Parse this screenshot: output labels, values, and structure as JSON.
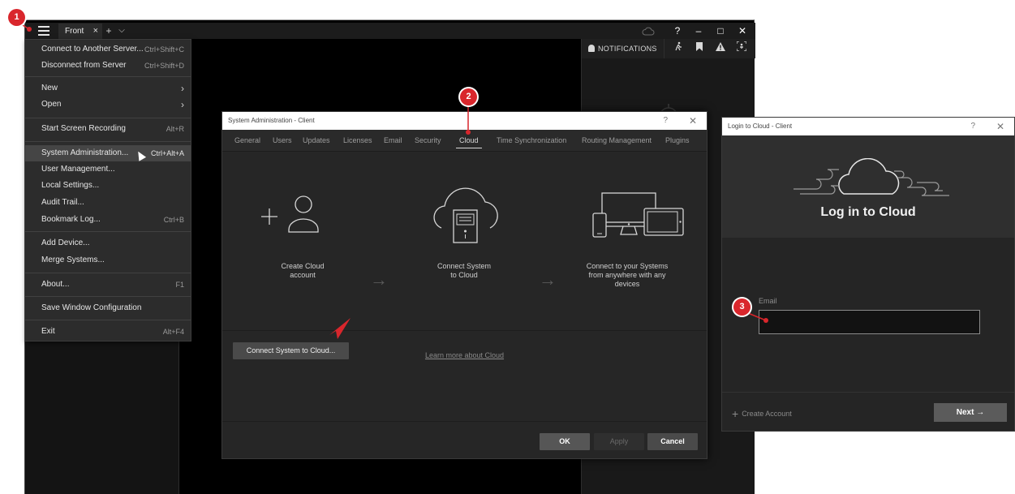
{
  "main_window": {
    "tab_label": "Front",
    "tab_close": "×",
    "add_tab": "+",
    "tab_menu": "⌵",
    "help": "?",
    "minimize": "–",
    "maximize": "□",
    "close": "✕",
    "notifications": {
      "label": "NOTIFICATIONS"
    }
  },
  "menu": {
    "items": [
      {
        "label": "Connect to Another Server...",
        "shortcut": "Ctrl+Shift+C"
      },
      {
        "label": "Disconnect from Server",
        "shortcut": "Ctrl+Shift+D"
      },
      {
        "label": "New",
        "shortcut": "›"
      },
      {
        "label": "Open",
        "shortcut": "›"
      },
      {
        "label": "Start Screen Recording",
        "shortcut": "Alt+R"
      },
      {
        "label": "System Administration...",
        "shortcut": "Ctrl+Alt+A"
      },
      {
        "label": "User Management...",
        "shortcut": ""
      },
      {
        "label": "Local Settings...",
        "shortcut": ""
      },
      {
        "label": "Audit Trail...",
        "shortcut": ""
      },
      {
        "label": "Bookmark Log...",
        "shortcut": "Ctrl+B"
      },
      {
        "label": "Add Device...",
        "shortcut": ""
      },
      {
        "label": "Merge Systems...",
        "shortcut": ""
      },
      {
        "label": "About...",
        "shortcut": "F1"
      },
      {
        "label": "Save Window Configuration",
        "shortcut": ""
      },
      {
        "label": "Exit",
        "shortcut": "Alt+F4"
      }
    ]
  },
  "sysadmin": {
    "title": "System Administration - Client",
    "help": "?",
    "close": "✕",
    "tabs": [
      "General",
      "Users",
      "Updates",
      "Licenses",
      "Email",
      "Security",
      "Cloud",
      "Time Synchronization",
      "Routing Management",
      "Plugins"
    ],
    "active_tab": "Cloud",
    "steps": [
      {
        "line1": "Create Cloud",
        "line2": "account",
        "line3": ""
      },
      {
        "line1": "Connect System",
        "line2": "to Cloud",
        "line3": ""
      },
      {
        "line1": "Connect to your Systems",
        "line2": "from anywhere with any",
        "line3": "devices"
      }
    ],
    "arrow": "→",
    "learn_more": "Learn more about Cloud",
    "connect_button": "Connect System to Cloud...",
    "ok": "OK",
    "apply": "Apply",
    "cancel": "Cancel"
  },
  "login": {
    "window_title": "Login to Cloud - Client",
    "help": "?",
    "close": "✕",
    "heading": "Log in to Cloud",
    "email_label": "Email",
    "email_value": "",
    "create_account": "Create Account",
    "create_plus": "+",
    "next": "Next →"
  },
  "callouts": {
    "one": "1",
    "two": "2",
    "three": "3"
  },
  "colors": {
    "callout": "#d9262c",
    "window_bg": "#000000",
    "dialog_bg": "#262626"
  }
}
